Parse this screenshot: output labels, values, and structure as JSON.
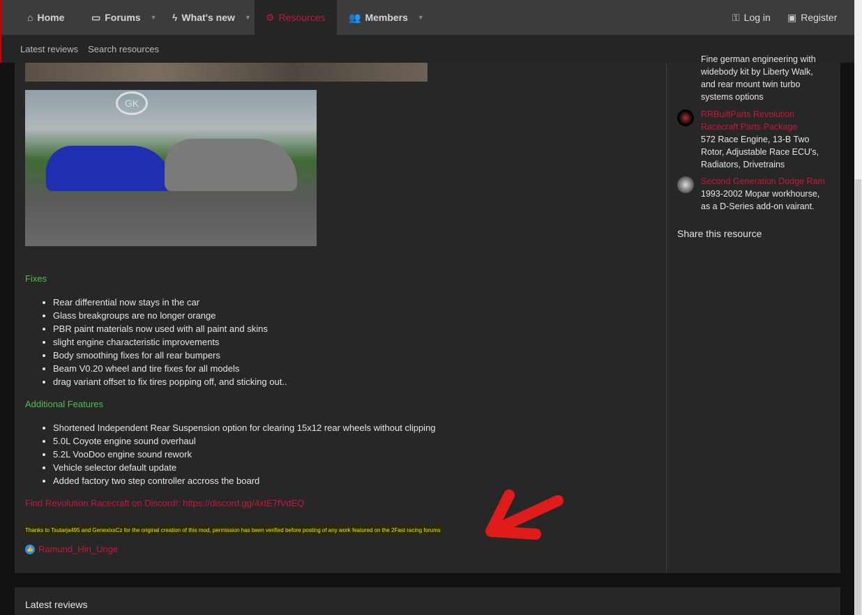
{
  "nav": {
    "items": [
      {
        "label": "Home",
        "icon": "home-icon"
      },
      {
        "label": "Forums",
        "icon": "forums-icon"
      },
      {
        "label": "What's new",
        "icon": "bolt-icon"
      },
      {
        "label": "Resources",
        "icon": "gears-icon"
      },
      {
        "label": "Members",
        "icon": "members-icon"
      }
    ],
    "login": "Log in",
    "register": "Register"
  },
  "subnav": [
    "Latest reviews",
    "Search resources"
  ],
  "content": {
    "image_logo": "GK",
    "fixes_heading": "Fixes",
    "fixes": [
      "Rear differential now stays in the car",
      "Glass breakgroups are no longer orange",
      "PBR paint materials now used with all paint and skins",
      "slight engine characteristic improvements",
      "Body smoothing fixes for all rear bumpers",
      "Beam V0.20 wheel and tire fixes for all models",
      "drag variant offset to fix tires popping off, and sticking out.."
    ],
    "features_heading": "Additional Features",
    "features": [
      "Shortened Independent Rear Suspension option for clearing 15x12 rear wheels without clipping",
      "5.0L Coyote engine sound overhaul",
      "5.2L VooDoo engine sound rework",
      "Vehicle selector default update",
      "Added factory two step controller accross the board"
    ],
    "discord": "Find Revolution Racecraft on Discord!: https://discord.gg/4xtE7fVdEQ",
    "thanks": "Thanks to Tsutarja495 and GenexixsCz for the original creation of this mod, permission has been verified before posting of any work featured on the 2Fast racing forums",
    "reaction_user": "Ramund_Hin_Unge"
  },
  "sidebar": {
    "partial": {
      "lines": [
        "Fine german engineering with",
        "widebody kit by Liberty Walk,",
        "and rear mount twin turbo",
        "systems options"
      ]
    },
    "items": [
      {
        "title1": "RRBuiltParts Revolution",
        "title2": "Racecraft Parts Package",
        "desc": [
          "572 Race Engine, 13-B Two",
          "Rotor, Adjustable Race ECU's,",
          "Radiators, Drivetrains"
        ]
      },
      {
        "title1": "Second Generation Dodge Ram",
        "desc": [
          "1993-2002 Mopar workhourse,",
          "as a D-Series add-on vairant."
        ]
      }
    ],
    "share": "Share this resource"
  },
  "bottom": {
    "title": "Latest reviews"
  },
  "colors": {
    "accent": "#c4183c",
    "heading": "#4fbf4f",
    "highlight": "#e8e800"
  }
}
